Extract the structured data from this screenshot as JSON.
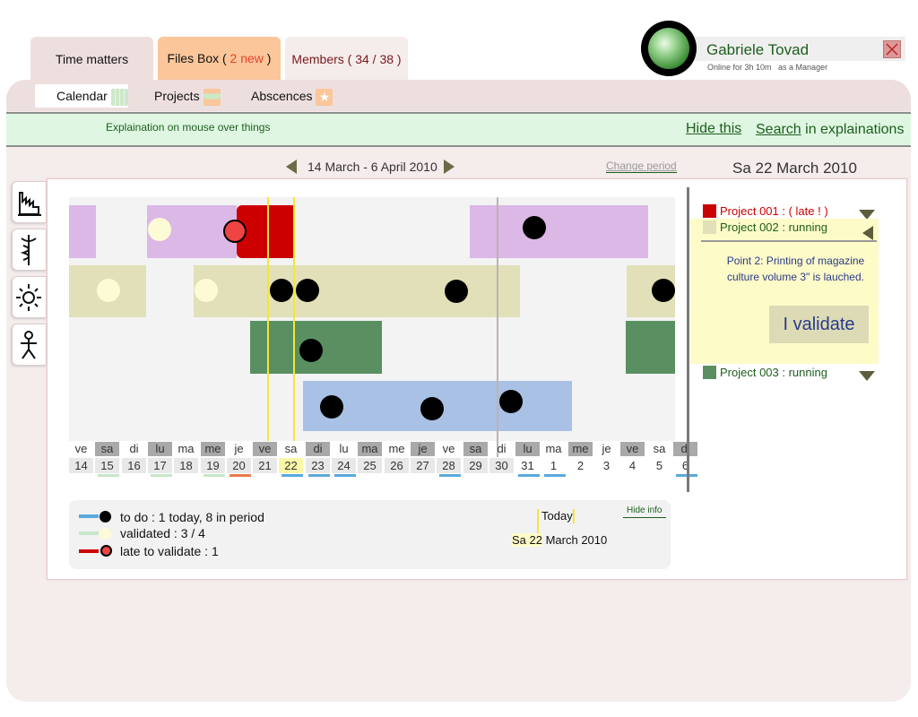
{
  "tabs": {
    "time_matters": "Time matters",
    "files_box_prefix": "Files Box ( ",
    "files_box_new": "2 new",
    "files_box_suffix": " )",
    "members": "Members ( 34 / 38 )"
  },
  "user": {
    "name": "Gabriele Tovad",
    "status": "Online for 3h 10m   as a Manager"
  },
  "subnav": {
    "calendar": "Calendar",
    "projects": "Projects",
    "absences": "Abscences"
  },
  "explanation": {
    "text": "Explaination on mouse over things",
    "hide": "Hide this",
    "search": "Search",
    "search_suffix": " in explainations"
  },
  "period": {
    "label": "14 March - 6 April 2010",
    "change": "Change period",
    "selected_date": "Sa 22 March 2010"
  },
  "side_icons": [
    "factory-icon",
    "caduceus-icon",
    "sun-icon",
    "person-icon"
  ],
  "days": [
    {
      "wd": "ve",
      "n": "14",
      "wd_shade": false,
      "n_shade": true,
      "line": ""
    },
    {
      "wd": "sa",
      "n": "15",
      "wd_shade": true,
      "n_shade": true,
      "line": "#c8e6c9"
    },
    {
      "wd": "di",
      "n": "16",
      "wd_shade": false,
      "n_shade": true,
      "line": ""
    },
    {
      "wd": "lu",
      "n": "17",
      "wd_shade": true,
      "n_shade": true,
      "line": "#c8e6c9"
    },
    {
      "wd": "ma",
      "n": "18",
      "wd_shade": false,
      "n_shade": true,
      "line": ""
    },
    {
      "wd": "me",
      "n": "19",
      "wd_shade": true,
      "n_shade": true,
      "line": "#c8e6c9"
    },
    {
      "wd": "je",
      "n": "20",
      "wd_shade": false,
      "n_shade": true,
      "line": "#e87a4a"
    },
    {
      "wd": "ve",
      "n": "21",
      "wd_shade": true,
      "n_shade": true,
      "line": ""
    },
    {
      "wd": "sa",
      "n": "22",
      "wd_shade": false,
      "n_shade": false,
      "today": true,
      "line": "#5aa9dc"
    },
    {
      "wd": "di",
      "n": "23",
      "wd_shade": true,
      "n_shade": true,
      "line": "#5aa9dc"
    },
    {
      "wd": "lu",
      "n": "24",
      "wd_shade": false,
      "n_shade": true,
      "line": "#5aa9dc"
    },
    {
      "wd": "ma",
      "n": "25",
      "wd_shade": true,
      "n_shade": true,
      "line": ""
    },
    {
      "wd": "me",
      "n": "26",
      "wd_shade": false,
      "n_shade": true,
      "line": ""
    },
    {
      "wd": "je",
      "n": "27",
      "wd_shade": true,
      "n_shade": true,
      "line": ""
    },
    {
      "wd": "ve",
      "n": "28",
      "wd_shade": false,
      "n_shade": true,
      "line": "#5aa9dc"
    },
    {
      "wd": "sa",
      "n": "29",
      "wd_shade": true,
      "n_shade": true,
      "line": ""
    },
    {
      "wd": "di",
      "n": "30",
      "wd_shade": false,
      "n_shade": true,
      "line": ""
    },
    {
      "wd": "lu",
      "n": "31",
      "wd_shade": true,
      "n_shade": false,
      "line": "#5aa9dc"
    },
    {
      "wd": "ma",
      "n": "1",
      "wd_shade": false,
      "n_shade": false,
      "line": "#5aa9dc"
    },
    {
      "wd": "me",
      "n": "2",
      "wd_shade": true,
      "n_shade": false,
      "line": ""
    },
    {
      "wd": "je",
      "n": "3",
      "wd_shade": false,
      "n_shade": false,
      "line": ""
    },
    {
      "wd": "ve",
      "n": "4",
      "wd_shade": true,
      "n_shade": false,
      "line": ""
    },
    {
      "wd": "sa",
      "n": "5",
      "wd_shade": false,
      "n_shade": false,
      "line": ""
    },
    {
      "wd": "di",
      "n": "6",
      "wd_shade": true,
      "n_shade": false,
      "line": "#5aa9dc"
    }
  ],
  "legend": {
    "todo": "to do : 1 today, 8 in period",
    "validated": "validated : 3 / 4",
    "late": "late to validate : 1",
    "today_label": "Today",
    "today_date_prefix": "Sa 22",
    "today_date_suffix": " March 2010",
    "hide_info": "Hide info"
  },
  "projects": {
    "p1": "Project 001 : ( late ! )",
    "p2": "Project 002 : running",
    "p2_point": "Point 2: Printing of magazine culture volume 3\" is lauched.",
    "validate": "I validate",
    "p3": "Project 003 : running"
  },
  "colors": {
    "purple": "#dbb8e6",
    "khaki": "#e2e0b8",
    "green": "#5a9061",
    "blue": "#a9c1e4",
    "red": "#cc0000",
    "todo_blue": "#5aa9dc",
    "late_red": "#cc0000",
    "validated_green": "#c8e6c9"
  }
}
